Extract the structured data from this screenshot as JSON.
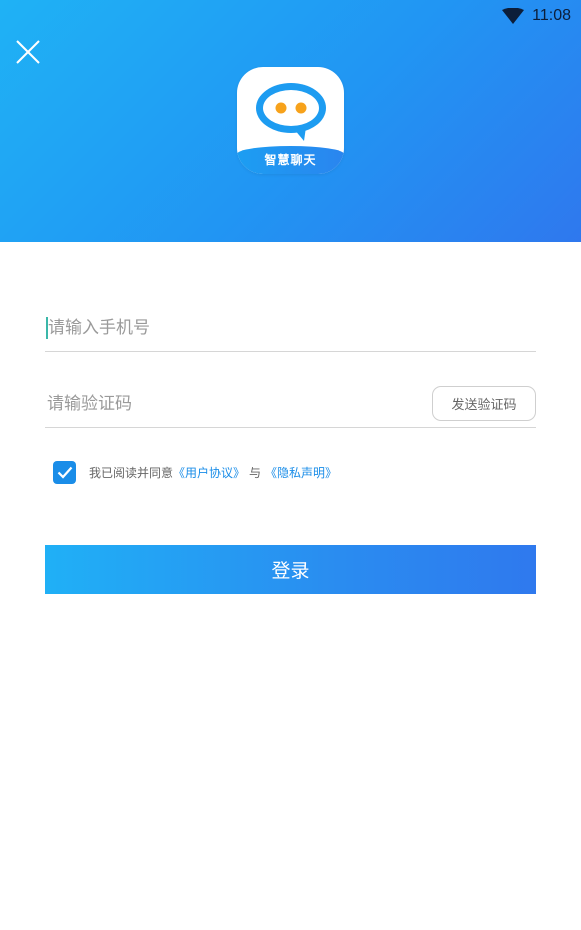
{
  "status_bar": {
    "time": "11:08",
    "wifi_icon": "wifi-icon"
  },
  "header": {
    "close_icon": "close-icon",
    "app_name": "智慧聊天",
    "gradient_colors": [
      "#1fb2f5",
      "#2f78ee"
    ]
  },
  "form": {
    "phone_placeholder": "请输入手机号",
    "code_placeholder": "请输验证码",
    "send_code_label": "发送验证码"
  },
  "agreement": {
    "checked": true,
    "prefix": "我已阅读并同意",
    "user_agreement": "《用户协议》",
    "and": "与",
    "privacy_policy": "《隐私声明》",
    "link_color": "#1a8de8"
  },
  "login": {
    "label": "登录"
  }
}
